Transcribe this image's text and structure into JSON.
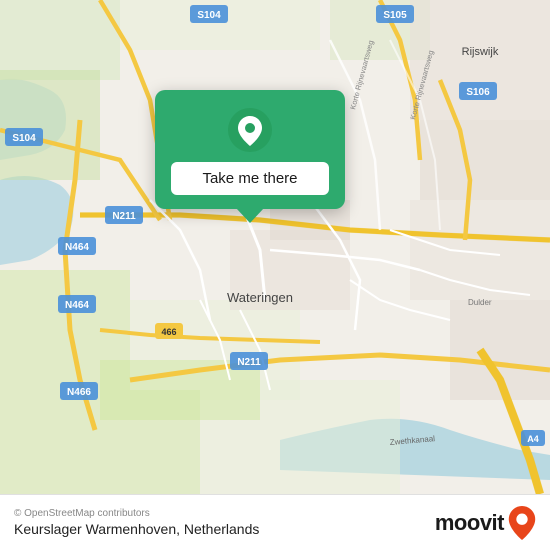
{
  "map": {
    "background_color": "#f2efe9"
  },
  "popup": {
    "button_label": "Take me there",
    "pin_icon": "location-pin"
  },
  "footer": {
    "copyright": "© OpenStreetMap contributors",
    "location_name": "Keurslager Warmenhoven, Netherlands",
    "brand": "moovit"
  },
  "road_labels": {
    "s104_top": "S104",
    "s104_left": "S104",
    "s105": "S105",
    "s106": "S106",
    "n211_left": "N211",
    "n211_bottom": "N211",
    "n464_top": "N464",
    "n464_bottom": "N464",
    "n466": "N466",
    "num_466": "466",
    "wateringen": "Wateringen",
    "rijswijk": "Rijswijk",
    "a4": "A4",
    "zwethkanaal": "Zwethkanaal"
  }
}
